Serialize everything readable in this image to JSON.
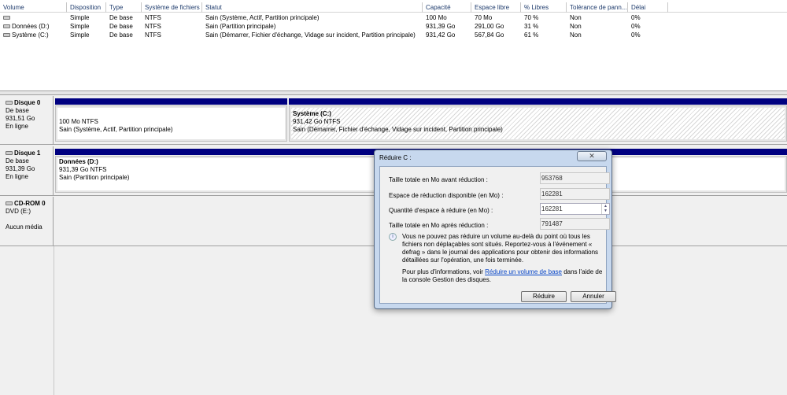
{
  "columns": [
    "Volume",
    "Disposition",
    "Type",
    "Système de fichiers",
    "Statut",
    "Capacité",
    "Espace libre",
    "% Libres",
    "Tolérance de pann...",
    "Délai"
  ],
  "rows": [
    [
      "",
      "Simple",
      "De base",
      "NTFS",
      "Sain (Système, Actif, Partition principale)",
      "100 Mo",
      "70 Mo",
      "70 %",
      "Non",
      "0%"
    ],
    [
      "Données (D:)",
      "Simple",
      "De base",
      "NTFS",
      "Sain (Partition principale)",
      "931,39 Go",
      "291,00 Go",
      "31 %",
      "Non",
      "0%"
    ],
    [
      "Système (C:)",
      "Simple",
      "De base",
      "NTFS",
      "Sain (Démarrer, Fichier d'échange, Vidage sur incident, Partition principale)",
      "931,42 Go",
      "567,84 Go",
      "61 %",
      "Non",
      "0%"
    ]
  ],
  "disks": [
    {
      "name": "Disque 0",
      "type": "De base",
      "size": "931,51 Go",
      "state": "En ligne",
      "parts": [
        {
          "name": "",
          "size": "100 Mo NTFS",
          "status": "Sain (Système, Actif, Partition principale)"
        },
        {
          "name": "Système  (C:)",
          "size": "931,42 Go NTFS",
          "status": "Sain (Démarrer, Fichier d'échange, Vidage sur incident, Partition principale)"
        }
      ]
    },
    {
      "name": "Disque 1",
      "type": "De base",
      "size": "931,39 Go",
      "state": "En ligne",
      "parts": [
        {
          "name": "Données  (D:)",
          "size": "931,39 Go NTFS",
          "status": "Sain (Partition principale)"
        }
      ]
    },
    {
      "name": "CD-ROM 0",
      "type": "DVD (E:)",
      "state": "Aucun média"
    }
  ],
  "dialog": {
    "title": "Réduire C :",
    "close": "✕",
    "fields": [
      {
        "label": "Taille totale en Mo avant réduction :",
        "value": "953768"
      },
      {
        "label": "Espace de réduction disponible (en Mo) :",
        "value": "162281"
      },
      {
        "label": "Quantité d'espace à réduire (en Mo) :",
        "value": "162281"
      },
      {
        "label": "Taille totale en Mo après réduction :",
        "value": "791487"
      }
    ],
    "info": "Vous ne pouvez pas réduire un volume au-delà du point où tous les fichiers non déplaçables sont situés. Reportez-vous à l'événement « defrag » dans le journal des applications pour obtenir des informations détaillées sur l'opération, une fois terminée.",
    "more_pre": "Pour plus d'informations, voir ",
    "more_link": "Réduire un volume de base",
    "more_post": " dans l'aide de la console Gestion des disques.",
    "ok": "Réduire",
    "cancel": "Annuler"
  }
}
